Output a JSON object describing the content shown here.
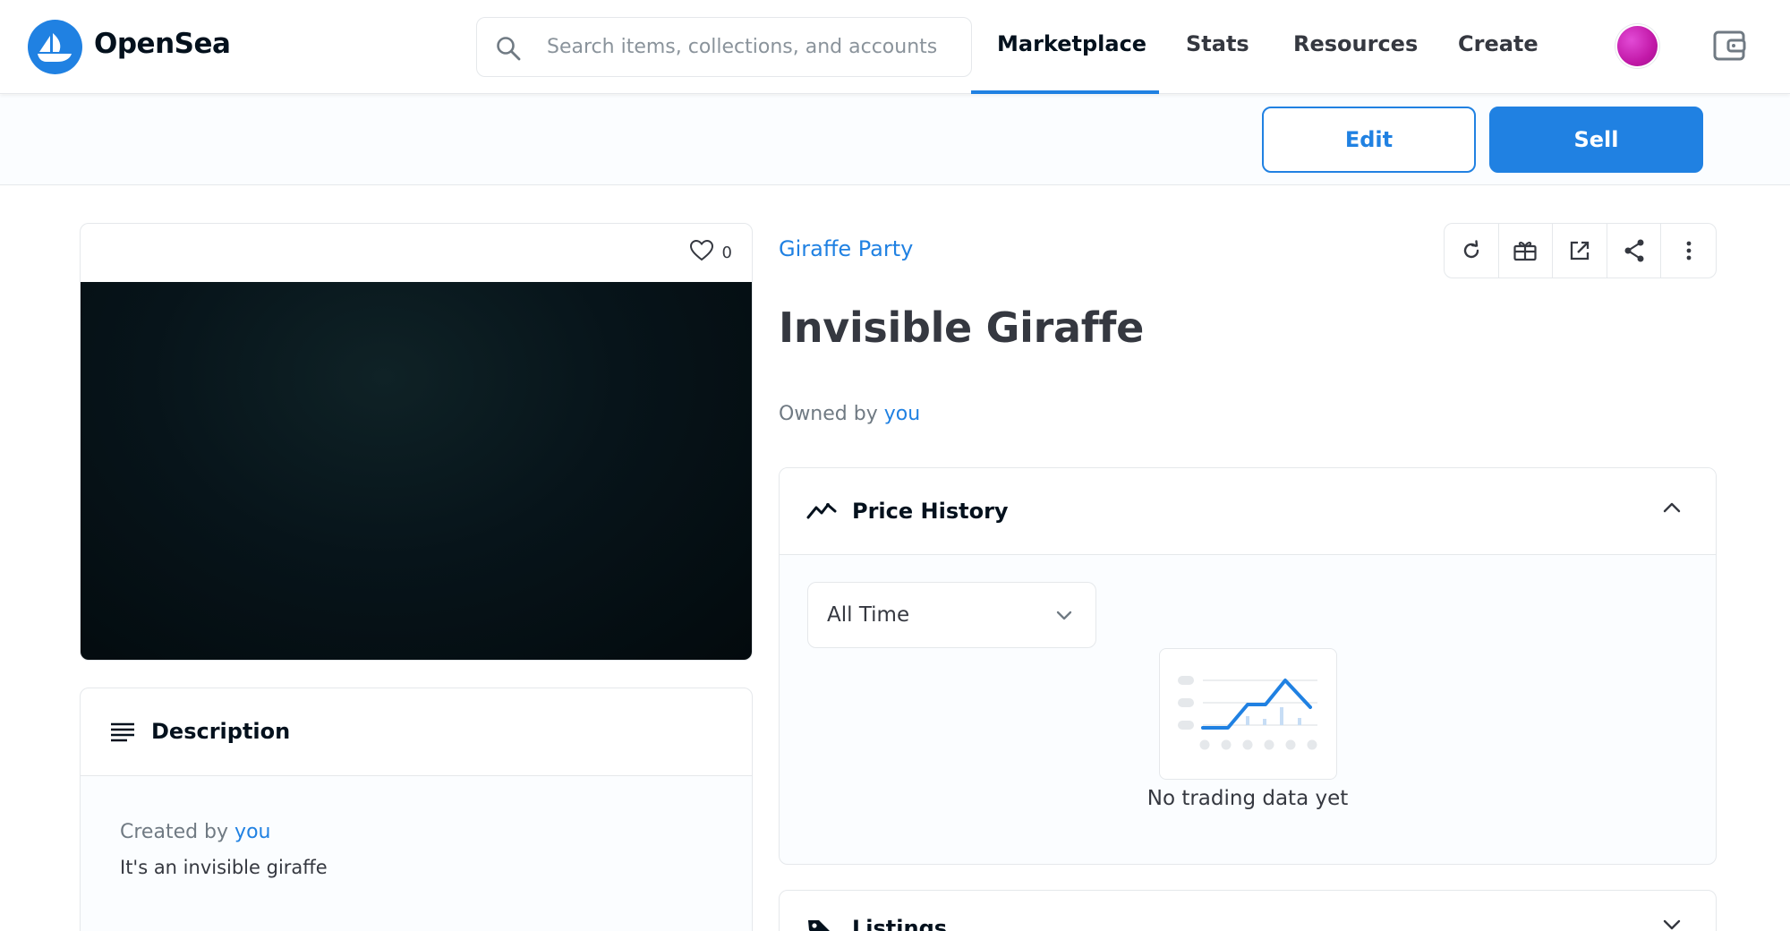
{
  "header": {
    "brand": "OpenSea",
    "search_placeholder": "Search items, collections, and accounts",
    "nav": [
      {
        "label": "Marketplace",
        "active": true
      },
      {
        "label": "Stats",
        "active": false
      },
      {
        "label": "Resources",
        "active": false
      },
      {
        "label": "Create",
        "active": false
      }
    ]
  },
  "actions": {
    "edit_label": "Edit",
    "sell_label": "Sell"
  },
  "item": {
    "favorites_count": "0",
    "collection": "Giraffe Party",
    "title": "Invisible Giraffe",
    "owned_by_prefix": "Owned by",
    "owner": "you"
  },
  "description": {
    "title": "Description",
    "created_by_prefix": "Created by",
    "creator": "you",
    "text": "It's an invisible giraffe"
  },
  "price_history": {
    "title": "Price History",
    "period_selected": "All Time",
    "empty_text": "No trading data yet"
  },
  "listings": {
    "title": "Listings"
  },
  "colors": {
    "accent": "#2081e2",
    "text_primary": "#353840",
    "text_secondary": "#707a83",
    "border": "#e5e8eb"
  },
  "icons": {
    "logo": "opensea-ship-icon",
    "search": "search-icon",
    "wallet": "wallet-icon",
    "favorite": "heart-icon",
    "refresh": "refresh-icon",
    "transfer": "gift-icon",
    "external": "external-link-icon",
    "share": "share-icon",
    "more": "more-vertical-icon",
    "description": "lines-icon",
    "price_history": "trend-line-icon",
    "listings": "tag-icon"
  }
}
